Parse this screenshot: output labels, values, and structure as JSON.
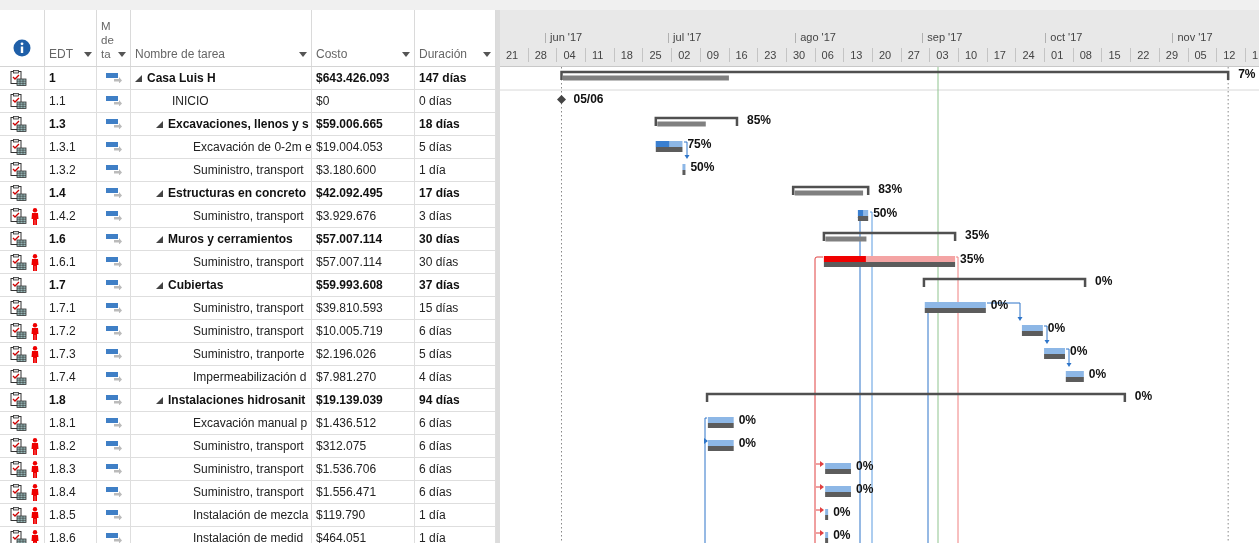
{
  "table": {
    "columns": [
      {
        "label": "EDT"
      },
      {
        "label": "M de ta"
      },
      {
        "label": "Nombre de tarea"
      },
      {
        "label": "Costo"
      },
      {
        "label": "Duración"
      }
    ]
  },
  "timeline": {
    "months": [
      "jun '17",
      "jul '17",
      "ago '17",
      "sep '17",
      "oct '17",
      "nov '17"
    ],
    "weeks": [
      "21",
      "28",
      "04",
      "11",
      "18",
      "25",
      "02",
      "09",
      "16",
      "23",
      "30",
      "06",
      "13",
      "20",
      "27",
      "03",
      "10",
      "17",
      "24",
      "01",
      "08",
      "15",
      "22",
      "29",
      "05",
      "12",
      "1"
    ]
  },
  "tasks": [
    {
      "edt": "1",
      "name": "Casa Luis H",
      "cost": "$643.426.093",
      "duration": "147 días",
      "kind": "summary",
      "expanded": true,
      "overallocated": false,
      "bar_label": "7%",
      "children": [
        {
          "edt": "1.1",
          "name": "INICIO",
          "cost": "$0",
          "duration": "0 días",
          "kind": "milestone",
          "overallocated": false,
          "bar_label": "05/06"
        },
        {
          "edt": "1.3",
          "name": "Excavaciones, llenos y s",
          "cost": "$59.006.665",
          "duration": "18 días",
          "kind": "summary",
          "expanded": true,
          "overallocated": false,
          "bar_label": "85%",
          "children": [
            {
              "edt": "1.3.1",
              "name": "Excavación de 0-2m e",
              "cost": "$19.004.053",
              "duration": "5 días",
              "kind": "task",
              "critical": false,
              "overallocated": false,
              "bar_label": "75%"
            },
            {
              "edt": "1.3.2",
              "name": "Suministro, transport",
              "cost": "$3.180.600",
              "duration": "1 día",
              "kind": "task",
              "critical": false,
              "overallocated": false,
              "bar_label": "50%"
            }
          ]
        },
        {
          "edt": "1.4",
          "name": "Estructuras en concreto",
          "cost": "$42.092.495",
          "duration": "17 días",
          "kind": "summary",
          "expanded": true,
          "overallocated": false,
          "bar_label": "83%",
          "children": [
            {
              "edt": "1.4.2",
              "name": "Suministro, transport",
              "cost": "$3.929.676",
              "duration": "3 días",
              "kind": "task",
              "critical": false,
              "overallocated": true,
              "bar_label": "50%"
            }
          ]
        },
        {
          "edt": "1.6",
          "name": "Muros y cerramientos",
          "cost": "$57.007.114",
          "duration": "30 días",
          "kind": "summary",
          "expanded": true,
          "overallocated": false,
          "bar_label": "35%",
          "children": [
            {
              "edt": "1.6.1",
              "name": "Suministro, transport",
              "cost": "$57.007.114",
              "duration": "30 días",
              "kind": "task",
              "critical": true,
              "overallocated": true,
              "bar_label": "35%"
            }
          ]
        },
        {
          "edt": "1.7",
          "name": "Cubiertas",
          "cost": "$59.993.608",
          "duration": "37 días",
          "kind": "summary",
          "expanded": true,
          "overallocated": false,
          "bar_label": "0%",
          "children": [
            {
              "edt": "1.7.1",
              "name": "Suministro, transport",
              "cost": "$39.810.593",
              "duration": "15 días",
              "kind": "task",
              "critical": false,
              "overallocated": false,
              "bar_label": "0%"
            },
            {
              "edt": "1.7.2",
              "name": "Suministro, transport",
              "cost": "$10.005.719",
              "duration": "6 días",
              "kind": "task",
              "critical": false,
              "overallocated": true,
              "bar_label": "0%"
            },
            {
              "edt": "1.7.3",
              "name": "Suministro, tranporte",
              "cost": "$2.196.026",
              "duration": "5 días",
              "kind": "task",
              "critical": false,
              "overallocated": true,
              "bar_label": "0%"
            },
            {
              "edt": "1.7.4",
              "name": "Impermeabilización d",
              "cost": "$7.981.270",
              "duration": "4 días",
              "kind": "task",
              "critical": false,
              "overallocated": false,
              "bar_label": "0%"
            }
          ]
        },
        {
          "edt": "1.8",
          "name": "Instalaciones hidrosanit",
          "cost": "$19.139.039",
          "duration": "94 días",
          "kind": "summary",
          "expanded": true,
          "overallocated": false,
          "bar_label": "0%",
          "children": [
            {
              "edt": "1.8.1",
              "name": "Excavación manual p",
              "cost": "$1.436.512",
              "duration": "6 días",
              "kind": "task",
              "critical": false,
              "overallocated": false,
              "bar_label": "0%"
            },
            {
              "edt": "1.8.2",
              "name": "Suministro, transport",
              "cost": "$312.075",
              "duration": "6 días",
              "kind": "task",
              "critical": false,
              "overallocated": true,
              "bar_label": "0%"
            },
            {
              "edt": "1.8.3",
              "name": "Suministro, transport",
              "cost": "$1.536.706",
              "duration": "6 días",
              "kind": "task",
              "critical": false,
              "overallocated": true,
              "bar_label": "0%"
            },
            {
              "edt": "1.8.4",
              "name": "Suministro, transport",
              "cost": "$1.556.471",
              "duration": "6 días",
              "kind": "task",
              "critical": false,
              "overallocated": true,
              "bar_label": "0%"
            },
            {
              "edt": "1.8.5",
              "name": "Instalación de mezcla",
              "cost": "$119.790",
              "duration": "1 día",
              "kind": "task",
              "critical": false,
              "overallocated": true,
              "bar_label": "0%"
            },
            {
              "edt": "1.8.6",
              "name": "Instalación de medid",
              "cost": "$464.051",
              "duration": "1 día",
              "kind": "task",
              "critical": false,
              "overallocated": true,
              "bar_label": "0%"
            }
          ]
        }
      ]
    }
  ]
}
